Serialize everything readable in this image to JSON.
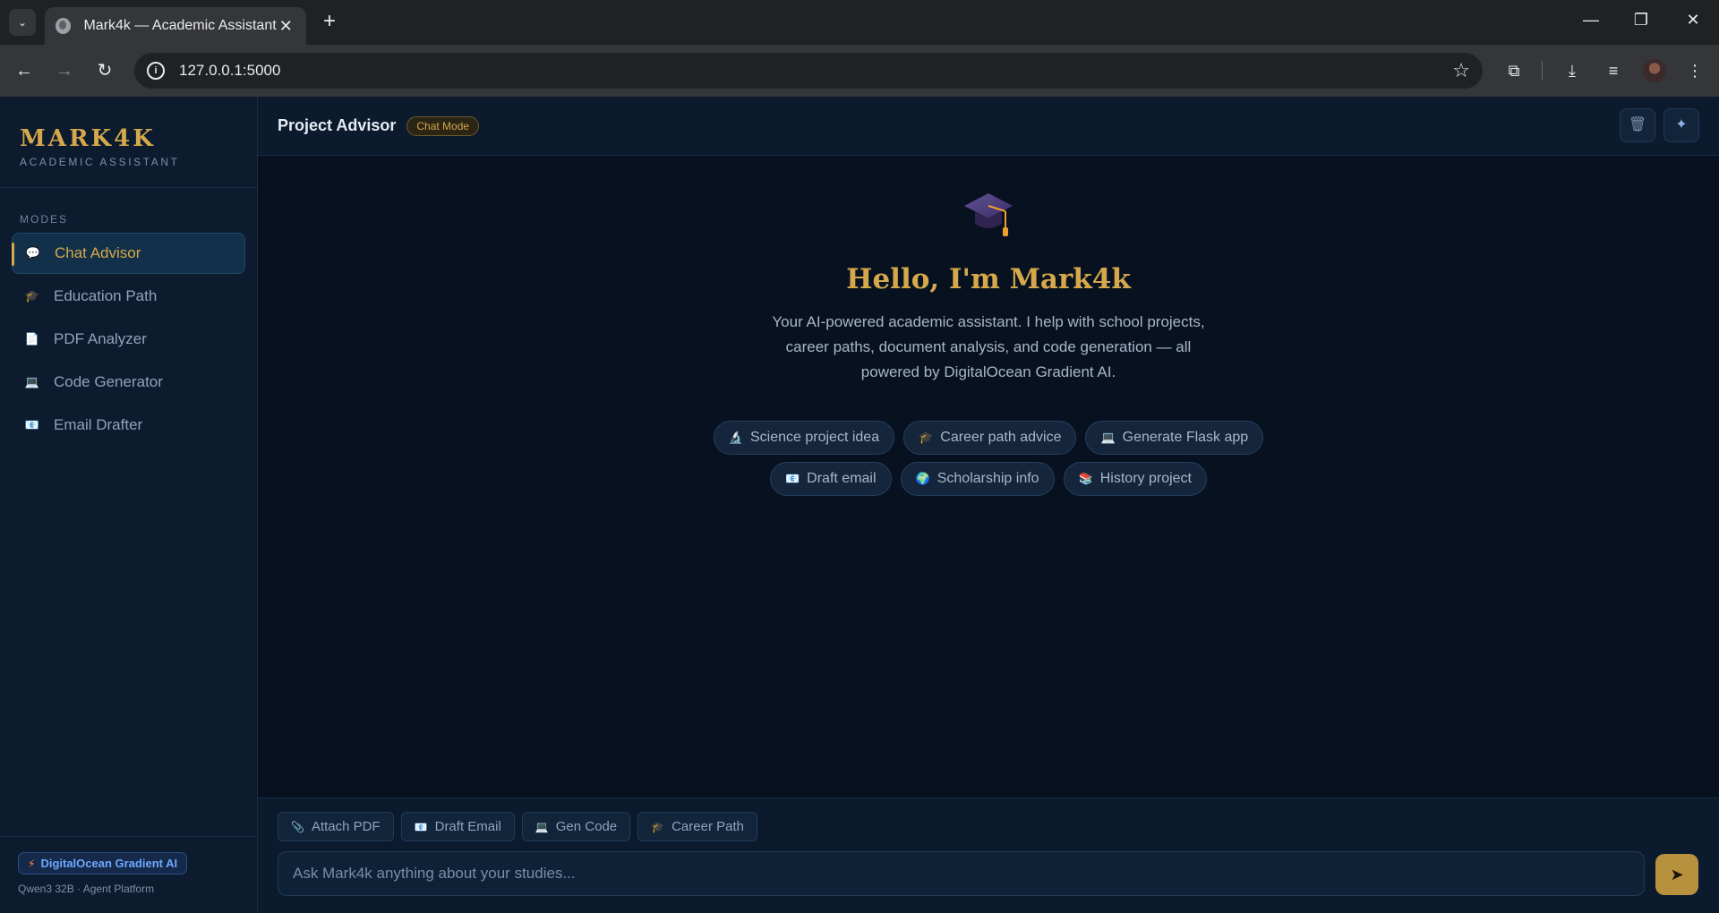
{
  "browser": {
    "tab_title": "Mark4k — Academic Assistant",
    "url": "127.0.0.1:5000"
  },
  "sidebar": {
    "brand_title": "MARK4K",
    "brand_subtitle": "ACADEMIC ASSISTANT",
    "modes_label": "MODES",
    "items": [
      {
        "label": "Chat Advisor",
        "icon": "speech-bubble-icon",
        "glyph": "💬",
        "active": true
      },
      {
        "label": "Education Path",
        "icon": "graduation-cap-icon",
        "glyph": "🎓",
        "active": false
      },
      {
        "label": "PDF Analyzer",
        "icon": "document-icon",
        "glyph": "📄",
        "active": false
      },
      {
        "label": "Code Generator",
        "icon": "laptop-icon",
        "glyph": "💻",
        "active": false
      },
      {
        "label": "Email Drafter",
        "icon": "email-icon",
        "glyph": "📧",
        "active": false
      }
    ],
    "footer_badge": "DigitalOcean Gradient AI",
    "footer_model": "Qwen3 32B · Agent Platform"
  },
  "topbar": {
    "title": "Project Advisor",
    "mode_pill": "Chat Mode"
  },
  "welcome": {
    "heading": "Hello, I'm Mark4k",
    "description": "Your AI-powered academic assistant. I help with school projects, career paths, document analysis, and code generation — all powered by DigitalOcean Gradient AI.",
    "chips_row1": [
      {
        "label": "Science project idea",
        "glyph": "🔬",
        "icon": "microscope-icon"
      },
      {
        "label": "Career path advice",
        "glyph": "🎓",
        "icon": "graduation-cap-icon"
      },
      {
        "label": "Generate Flask app",
        "glyph": "💻",
        "icon": "laptop-icon"
      }
    ],
    "chips_row2": [
      {
        "label": "Draft email",
        "glyph": "📧",
        "icon": "email-icon"
      },
      {
        "label": "Scholarship info",
        "glyph": "🌍",
        "icon": "globe-icon"
      },
      {
        "label": "History project",
        "glyph": "📚",
        "icon": "books-icon"
      }
    ]
  },
  "composer": {
    "quick_actions": [
      {
        "label": "Attach PDF",
        "glyph": "📎",
        "icon": "paperclip-icon"
      },
      {
        "label": "Draft Email",
        "glyph": "📧",
        "icon": "email-icon"
      },
      {
        "label": "Gen Code",
        "glyph": "💻",
        "icon": "laptop-icon"
      },
      {
        "label": "Career Path",
        "glyph": "🎓",
        "icon": "graduation-cap-icon"
      }
    ],
    "placeholder": "Ask Mark4k anything about your studies..."
  },
  "colors": {
    "accent_gold": "#d4a84b",
    "sidebar_bg": "#0d1b2e",
    "main_bg": "#081120",
    "gradient_blue": "#6ea8ff"
  }
}
